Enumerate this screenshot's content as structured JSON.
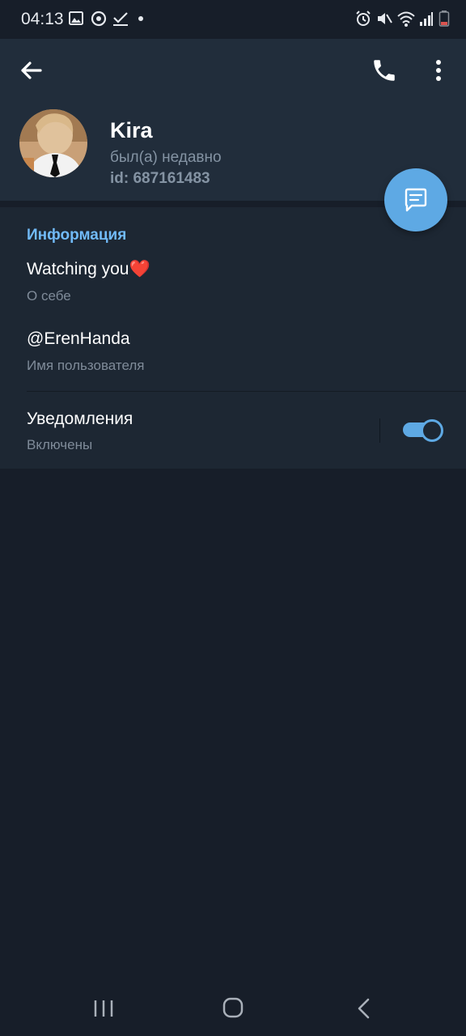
{
  "status_bar": {
    "time": "04:13",
    "left_icons": [
      "gallery-icon",
      "sync-icon",
      "check-icon",
      "dot-icon"
    ],
    "right_icons": [
      "alarm-icon",
      "mute-icon",
      "wifi-icon",
      "signal-icon",
      "battery-icon"
    ]
  },
  "header": {
    "back_icon": "arrow-left-icon",
    "call_icon": "phone-icon",
    "menu_icon": "more-vertical-icon"
  },
  "profile": {
    "name": "Kira",
    "status": "был(а) недавно",
    "id_line": "id: 687161483"
  },
  "fab": {
    "icon": "message-icon"
  },
  "info": {
    "section_title": "Информация",
    "bio": "Watching you❤️",
    "bio_label": "О себе",
    "username": "@ErenHanda",
    "username_label": "Имя пользователя",
    "notifications": "Уведомления",
    "notifications_state": "Включены",
    "notifications_enabled": true
  },
  "nav_bar": {
    "icons": [
      "recent-apps-icon",
      "home-icon",
      "back-nav-icon"
    ]
  },
  "colors": {
    "accent": "#5ea9e4",
    "section_title": "#71baf7",
    "header_bg": "#212d3b",
    "card_bg": "#1d2733",
    "page_bg": "#171e29"
  }
}
